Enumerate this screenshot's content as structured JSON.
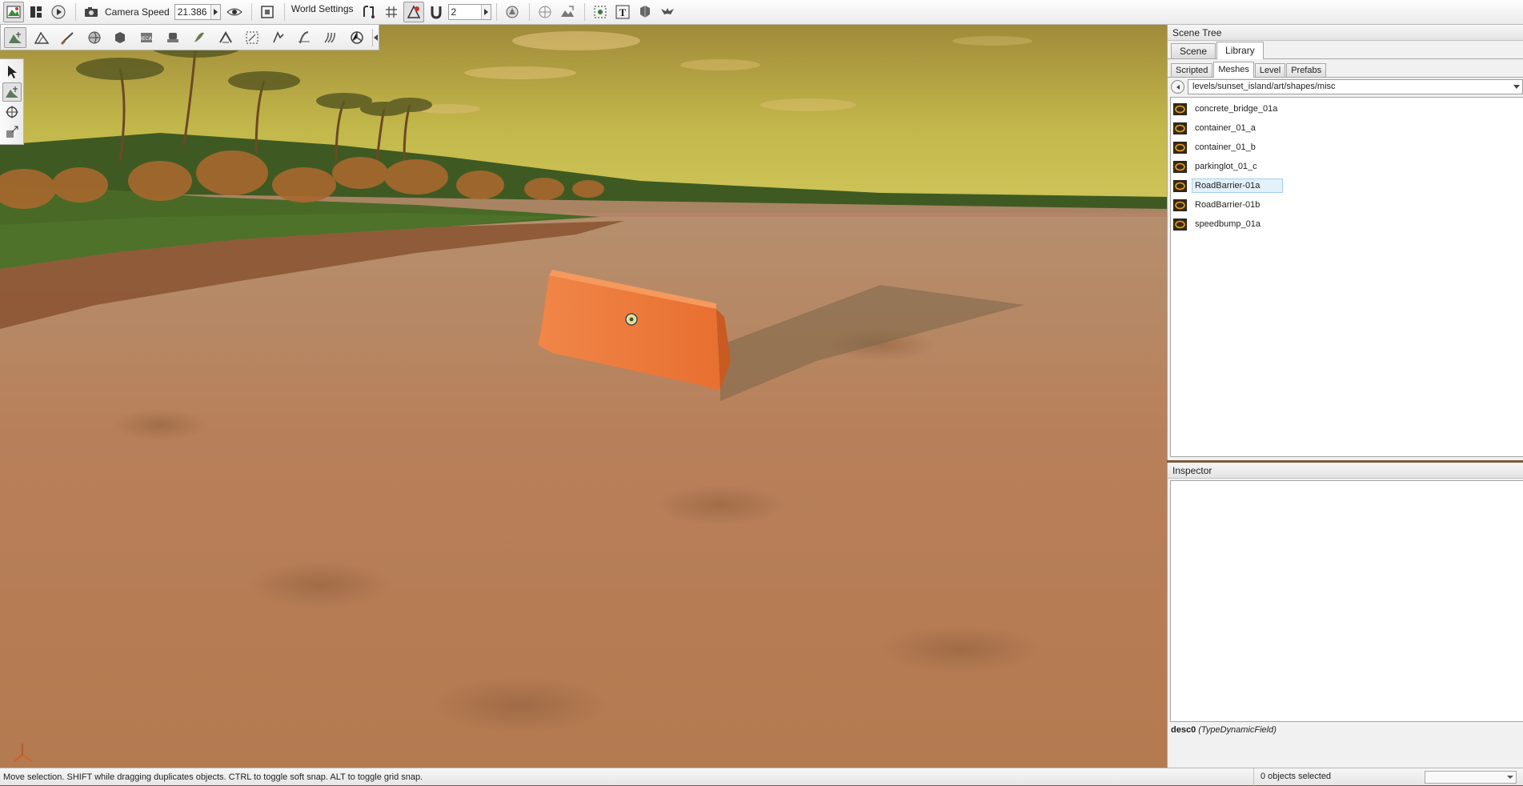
{
  "toolbar": {
    "camera_speed_label": "Camera Speed",
    "camera_speed_value": "21.386",
    "world_settings_label": "World Settings",
    "snap_value": "2",
    "icons": [
      "world-editor-icon",
      "layout-icon",
      "play-icon",
      "camera-icon",
      "eye-icon",
      "frame-icon",
      "snap-icon",
      "grid-icon",
      "object-snap-icon",
      "magnet-icon",
      "bounds-icon",
      "orbit-icon",
      "terrain-icon",
      "select-group-icon",
      "text-icon",
      "lighting-icon",
      "bird-icon"
    ]
  },
  "sub_toolbar": {
    "icons": [
      "object-editor-icon",
      "terrain-editor-icon",
      "terrain-painter-icon",
      "material-icon",
      "convex-icon",
      "decal-icon",
      "datablock-icon",
      "forest-icon",
      "river-icon",
      "mesh-road-icon",
      "sketch-icon",
      "road-icon",
      "particle-icon",
      "navmesh-icon"
    ]
  },
  "tool_palette": {
    "icons": [
      "select-arrow-icon",
      "move-icon",
      "rotate-icon",
      "scale-icon"
    ]
  },
  "scene_tree": {
    "title": "Scene Tree",
    "tabs": [
      {
        "label": "Scene",
        "active": false
      },
      {
        "label": "Library",
        "active": true
      }
    ],
    "subtabs": [
      {
        "label": "Scripted",
        "active": false
      },
      {
        "label": "Meshes",
        "active": true
      },
      {
        "label": "Level",
        "active": false
      },
      {
        "label": "Prefabs",
        "active": false
      }
    ],
    "path": "levels/sunset_island/art/shapes/misc",
    "meshes": [
      {
        "name": "concrete_bridge_01a",
        "selected": false
      },
      {
        "name": "container_01_a",
        "selected": false
      },
      {
        "name": "container_01_b",
        "selected": false
      },
      {
        "name": "parkinglot_01_c",
        "selected": false
      },
      {
        "name": "RoadBarrier-01a",
        "selected": true
      },
      {
        "name": "RoadBarrier-01b",
        "selected": false
      },
      {
        "name": "speedbump_01a",
        "selected": false
      }
    ]
  },
  "inspector": {
    "title": "Inspector",
    "desc_name": "desc0",
    "desc_type": "(TypeDynamicField)"
  },
  "status_bar": {
    "message": "Move selection.  SHIFT while dragging duplicates objects.  CTRL to toggle soft snap.  ALT to toggle grid snap.",
    "selection_count": "0 objects selected"
  },
  "colors": {
    "sky_top": "#a88c38",
    "sky_horizon": "#c8c050",
    "ground": "#b27a52",
    "barrier": "#f07a35",
    "grass": "#4a6a2a",
    "selection_highlight": "#e3f1fb"
  }
}
